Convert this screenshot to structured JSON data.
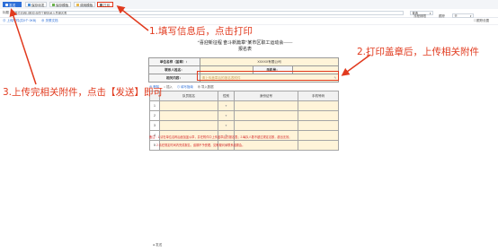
{
  "toolbar": {
    "buttons": [
      {
        "label": "发送"
      },
      {
        "label": "保存待发"
      },
      {
        "label": "保存模板"
      },
      {
        "label": "调用模板"
      },
      {
        "label": "打印"
      }
    ]
  },
  "form": {
    "title_label": "标题",
    "title_value": "[单位名称]-[报名]合同工程技术人员报名表",
    "right_select_1": "普通",
    "right_label_2": "流程期限",
    "right_select_2": "无",
    "right_label_3": "跟踪",
    "right_check": "跟踪设置",
    "upload_link": "上传附件(共0个 0KB)",
    "related_link": "关联文档"
  },
  "document": {
    "heading_line1": "“喜迎新征程 奋斗新篇章”某市区职工运动会——",
    "heading_line2": "报名表",
    "info_rows": [
      {
        "label": "单位名称（盖章）：",
        "value": "XXXXX有限公司"
      },
      {
        "label": "联系人姓名：",
        "mid_label": "手机号：",
        "mid_value": ""
      },
      {
        "label": "相关内容：",
        "value": "请上传盖章后的报名表附件"
      }
    ],
    "tabs": [
      "删除",
      "插入",
      "填写指南",
      "导入数据"
    ],
    "grid_headers": [
      "队员姓名",
      "性别",
      "身份证号",
      "手机号码"
    ],
    "grid_rows": [
      "1",
      "2",
      "3",
      "4",
      "5"
    ],
    "note_line1": "备注：1.请在单位名称后面加盖公章，并在附件中上传盖章后的报名表；2.每队人数不超过规定名额，超出无效；",
    "note_line2": "2.请在规定时间内完成报名，逾期不予受理，如有疑问请联系组委会。"
  },
  "bottom": {
    "label": "发送"
  },
  "annotations": {
    "a1": "1.填写信息后，点击打印",
    "a2": "2.打印盖章后，上传相关附件",
    "a3": "3.上传完相关附件，点击【发送】即可"
  },
  "colors": {
    "annotation": "#e13a1e",
    "send_button": "#2d6fd8",
    "fill_cell": "#fff4d9"
  }
}
